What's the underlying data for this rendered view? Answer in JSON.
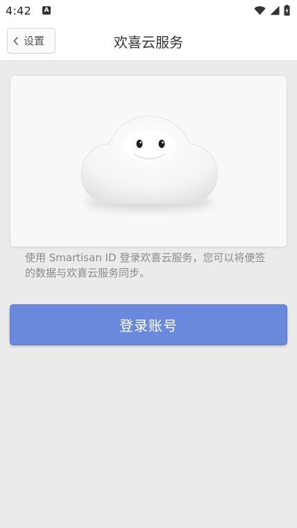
{
  "status_bar": {
    "time": "4:42",
    "notification_icon": "A"
  },
  "header": {
    "back_label": "设置",
    "title": "欢喜云服务"
  },
  "main": {
    "description": "使用 Smartisan ID 登录欢喜云服务，您可以将便签的数据与欢喜云服务同步。",
    "login_label": "登录账号"
  },
  "icons": {
    "wifi": "wifi-icon",
    "signal": "signal-icon",
    "battery": "battery-icon",
    "back": "chevron-left-icon",
    "illustration": "cloud-mascot-icon"
  },
  "colors": {
    "accent": "#6889dc",
    "background": "#ebebeb"
  }
}
